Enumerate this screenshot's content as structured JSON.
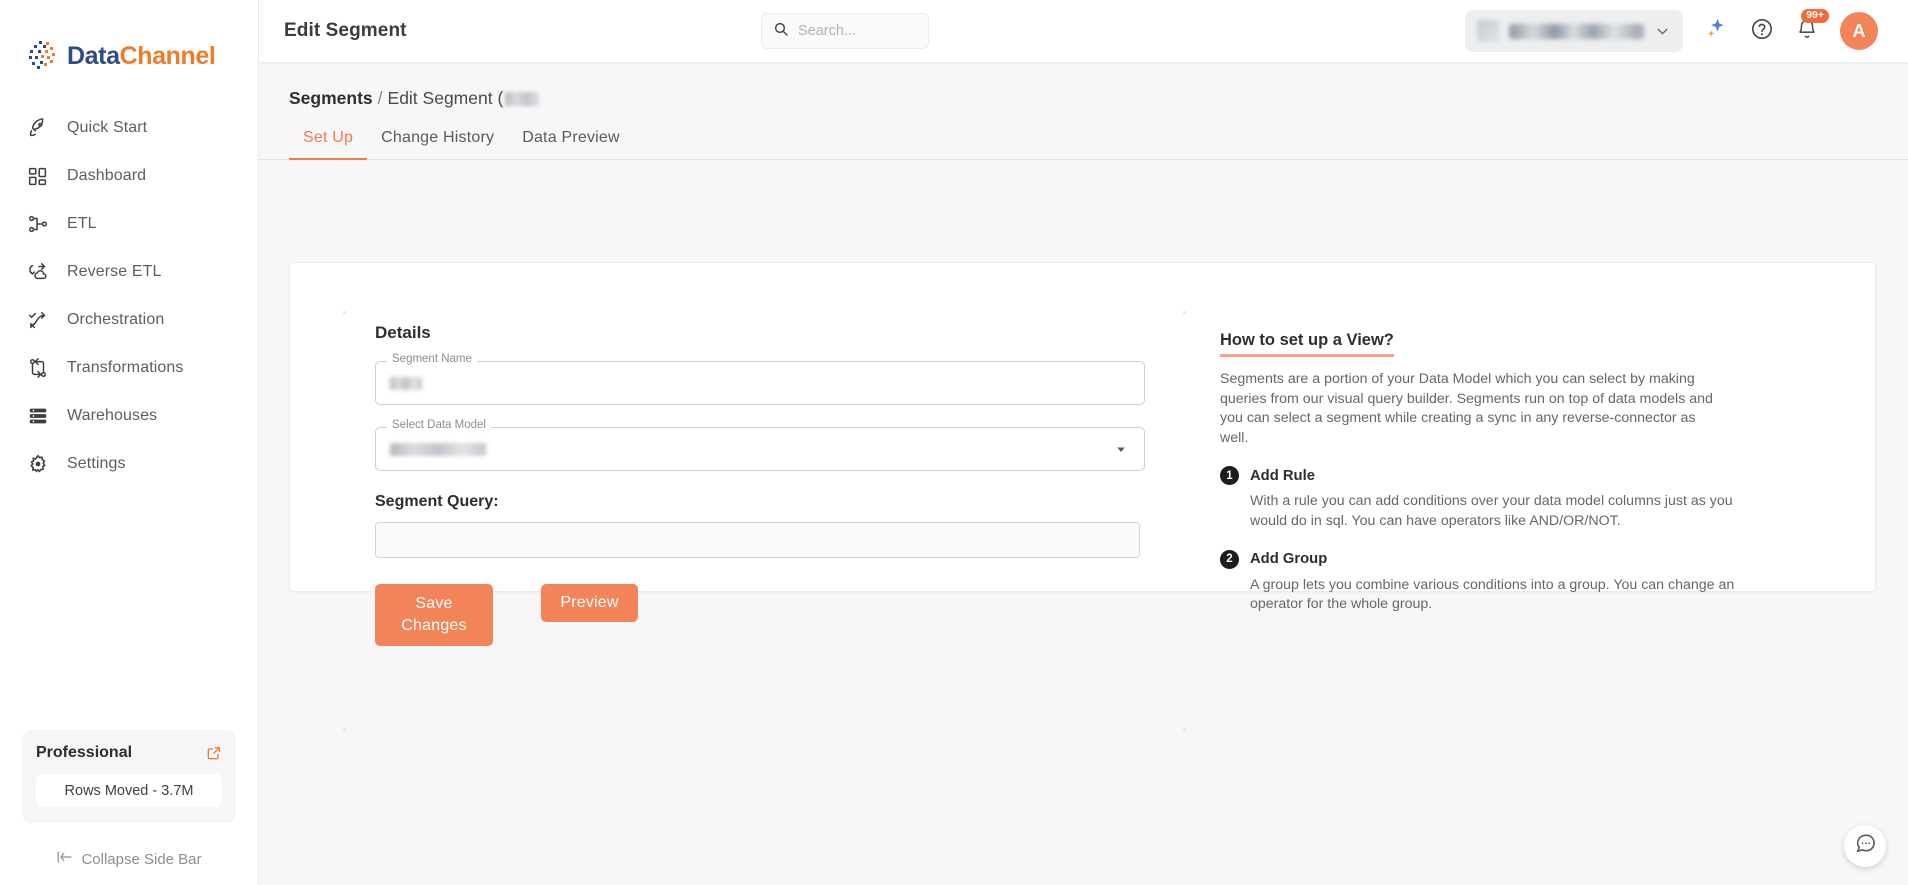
{
  "brand": {
    "name_part1": "Data",
    "name_part2": "Channel",
    "logo_icon": "datachannel-logo-icon",
    "color_blue": "#2d4b87",
    "color_orange": "#f07c29"
  },
  "sidebar": {
    "items": [
      {
        "label": "Quick Start",
        "icon": "rocket-icon"
      },
      {
        "label": "Dashboard",
        "icon": "dashboard-grid-icon"
      },
      {
        "label": "ETL",
        "icon": "etl-nodes-icon"
      },
      {
        "label": "Reverse ETL",
        "icon": "reverse-etl-cloud-icon"
      },
      {
        "label": "Orchestration",
        "icon": "orchestration-path-icon"
      },
      {
        "label": "Transformations",
        "icon": "transformations-swap-icon"
      },
      {
        "label": "Warehouses",
        "icon": "warehouse-stack-icon"
      },
      {
        "label": "Settings",
        "icon": "gear-icon"
      }
    ],
    "plan": {
      "name": "Professional",
      "external_icon": "external-link-icon",
      "rows_moved": "Rows Moved - 3.7M"
    },
    "collapse": {
      "label": "Collapse Side Bar",
      "icon": "collapse-left-icon"
    }
  },
  "header": {
    "title": "Edit Segment",
    "search": {
      "placeholder": "Search...",
      "value": "",
      "icon": "search-icon"
    },
    "workspace": {
      "name": "",
      "thumb_icon": "workspace-thumbnail-icon",
      "caret_icon": "chevron-down-icon"
    },
    "ai_icon": "sparkle-ai-icon",
    "help_icon": "help-circle-icon",
    "notifications": {
      "icon": "bell-icon",
      "badge": "99+"
    },
    "avatar": {
      "initial": "A"
    }
  },
  "breadcrumb": {
    "root": "Segments",
    "separator": "/",
    "current": "Edit Segment (",
    "redacted_name": ""
  },
  "tabs": [
    {
      "label": "Set Up",
      "active": true
    },
    {
      "label": "Change History",
      "active": false
    },
    {
      "label": "Data Preview",
      "active": false
    }
  ],
  "form": {
    "section_title": "Details",
    "segment_name": {
      "label": "Segment Name",
      "value": ""
    },
    "data_model": {
      "label": "Select Data Model",
      "value": "",
      "caret_icon": "chevron-down-icon"
    },
    "query": {
      "label": "Segment Query:",
      "value": ""
    },
    "save_label_line1": "Save",
    "save_label_line2": "Changes",
    "preview_label": "Preview",
    "accent_color": "#f3845a"
  },
  "help": {
    "title": "How to set up a View?",
    "intro": "Segments are a portion of your Data Model which you can select by making queries from our visual query builder. Segments run on top of data models and you can select a segment while creating a sync in any reverse-connector as well.",
    "steps": [
      {
        "num": "1",
        "title": "Add Rule",
        "body": "With a rule you can add conditions over your data model columns just as you would do in sql. You can have operators like AND/OR/NOT."
      },
      {
        "num": "2",
        "title": "Add Group",
        "body": "A group lets you combine various conditions into a group. You can change an operator for the whole group."
      }
    ]
  },
  "chat": {
    "icon": "chat-bubble-icon"
  }
}
